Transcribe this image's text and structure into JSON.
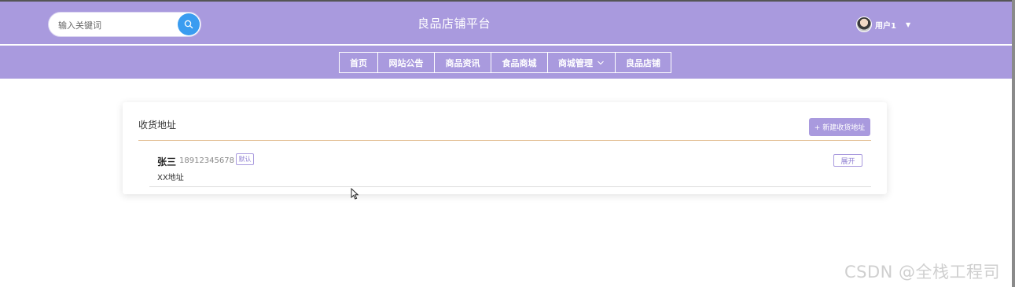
{
  "header": {
    "search": {
      "placeholder": "输入关键词"
    },
    "title": "良品店铺平台",
    "user": {
      "name": "用户1"
    }
  },
  "nav": {
    "items": [
      {
        "label": "首页"
      },
      {
        "label": "网站公告"
      },
      {
        "label": "商品资讯"
      },
      {
        "label": "食品商城"
      },
      {
        "label": "商城管理"
      },
      {
        "label": "良品店铺"
      }
    ]
  },
  "address_card": {
    "title": "收货地址",
    "add_label": "+ 新建收货地址",
    "entry": {
      "name": "张三",
      "phone": "18912345678",
      "default_badge": "默认",
      "detail": "XX地址",
      "expand_label": "展开"
    }
  },
  "watermark": "CSDN @全栈工程司",
  "colors": {
    "header_bg": "#a99ade",
    "search_button": "#3a9cf0",
    "accent_line": "#e0b98a"
  }
}
